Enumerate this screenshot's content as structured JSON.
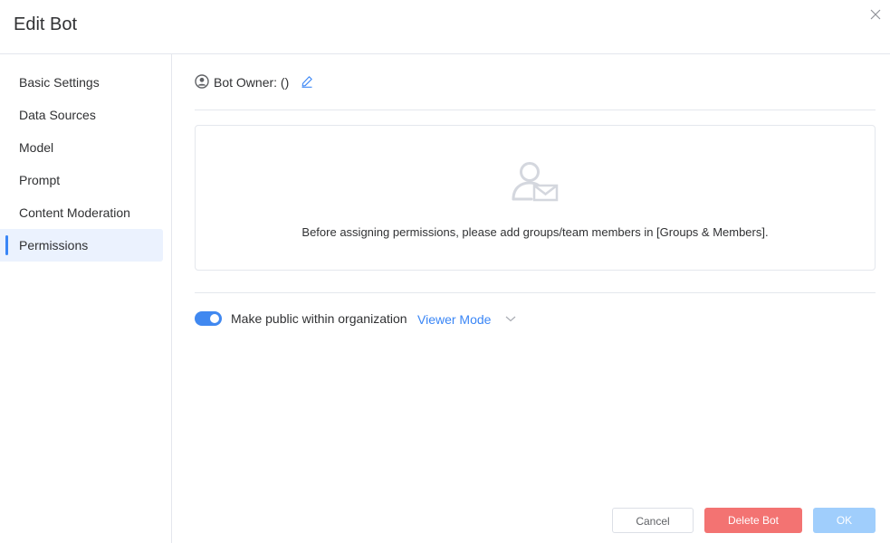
{
  "dialog": {
    "title": "Edit Bot"
  },
  "icons": {
    "close": "close-icon",
    "owner": "user-circle-icon",
    "edit": "pencil-icon",
    "empty": "user-mail-icon",
    "dropdown": "chevron-down-icon"
  },
  "sidebar": {
    "items": [
      {
        "label": "Basic Settings"
      },
      {
        "label": "Data Sources"
      },
      {
        "label": "Model"
      },
      {
        "label": "Prompt"
      },
      {
        "label": "Content Moderation"
      },
      {
        "label": "Permissions",
        "active": true
      }
    ]
  },
  "owner": {
    "label": "Bot Owner: ()"
  },
  "empty_state": {
    "message": "Before assigning permissions, please add groups/team members in [Groups & Members]."
  },
  "public": {
    "label": "Make public within organization",
    "enabled": true,
    "mode": "Viewer Mode"
  },
  "footer": {
    "cancel": "Cancel",
    "delete": "Delete Bot",
    "ok": "OK"
  },
  "colors": {
    "accent": "#3a86f6",
    "toggle": "#4088f0",
    "danger": "#f37372",
    "ok_disabled": "#a0cefc",
    "active_nav_bg": "#ebf2fe",
    "divider": "#e4e7ed"
  }
}
